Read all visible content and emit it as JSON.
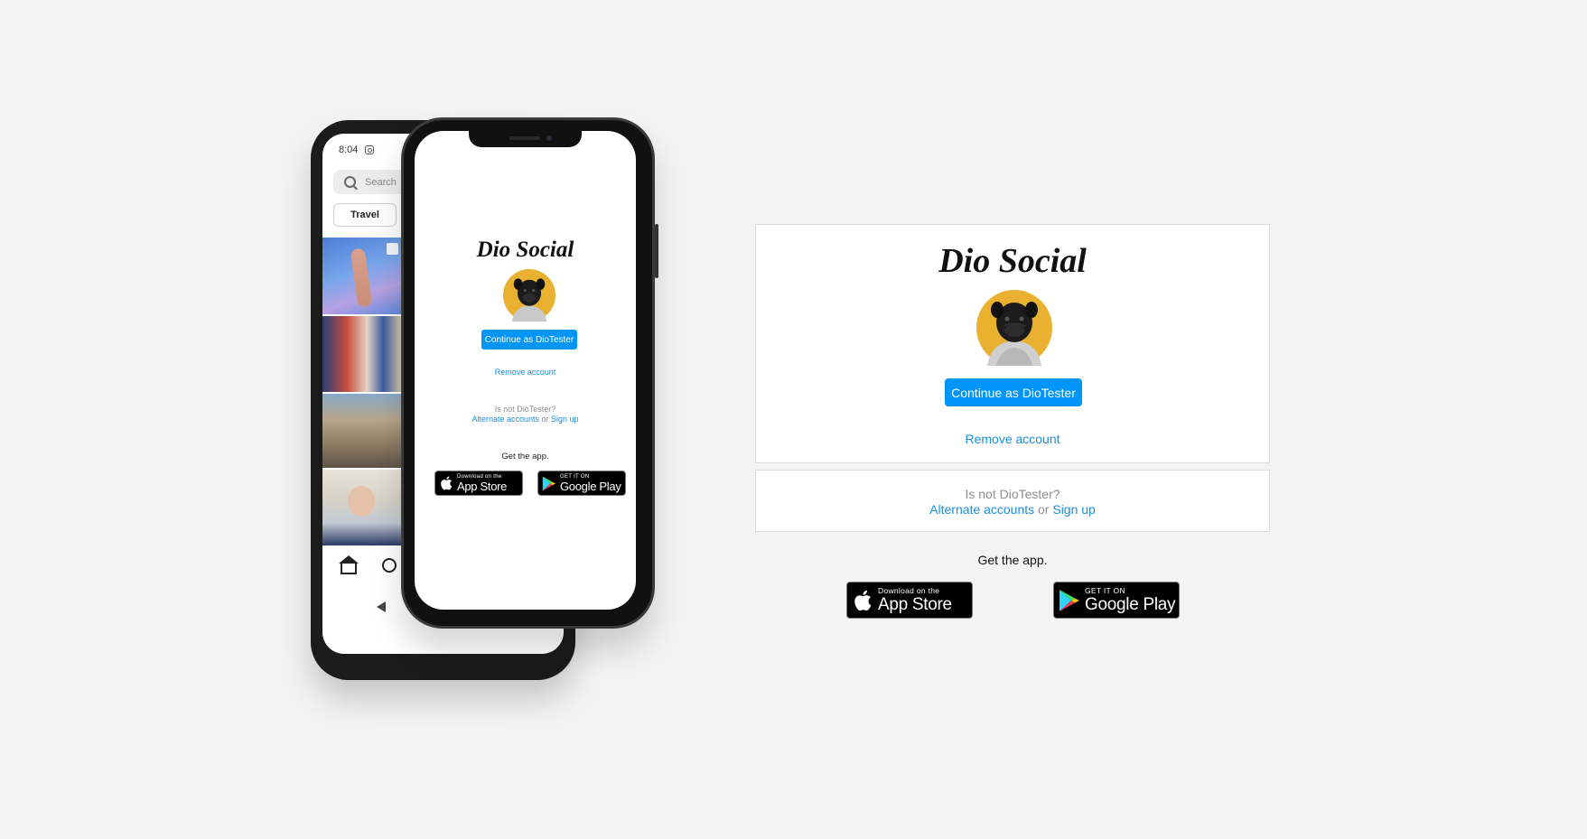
{
  "brand": {
    "name": "Dio Social"
  },
  "phone_back": {
    "time": "8:04",
    "search_placeholder": "Search",
    "chip": "Travel"
  },
  "account": {
    "continue_label": "Continue as DioTester",
    "remove_label": "Remove account"
  },
  "switch": {
    "not_user": "Is not DioTester?",
    "alternate": "Alternate accounts",
    "or": "or",
    "signup": "Sign up"
  },
  "get_app": {
    "label": "Get the app.",
    "appstore_small": "Download on the",
    "appstore_big": "App Store",
    "googleplay_small": "GET IT ON",
    "googleplay_big": "Google Play"
  },
  "colors": {
    "accent": "#0095f6",
    "link": "#1a8ddc",
    "avatar_bg": "#e9b12f",
    "background": "#f3f3f3",
    "border": "#dbdbdb"
  }
}
